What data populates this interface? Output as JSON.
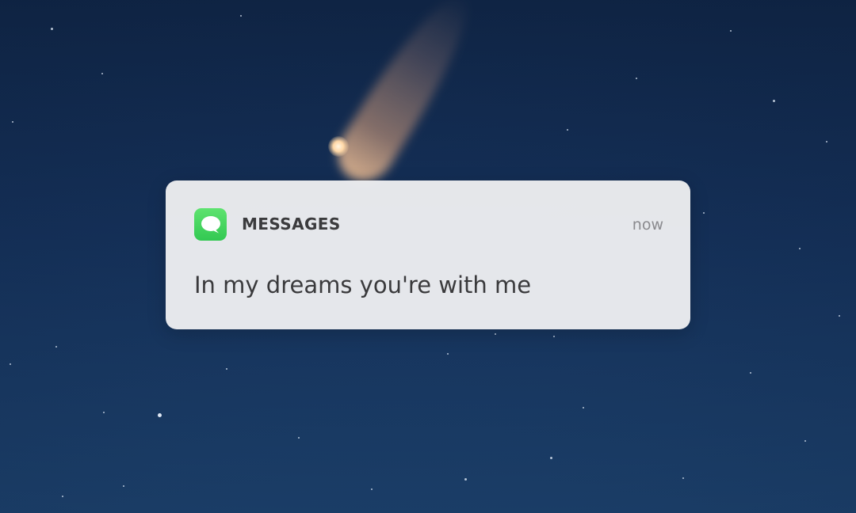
{
  "notification": {
    "app_name": "MESSAGES",
    "time": "now",
    "message": "In my dreams you're with me",
    "app_icon": "messages-bubble-icon",
    "app_icon_color": "#3DD35B"
  }
}
